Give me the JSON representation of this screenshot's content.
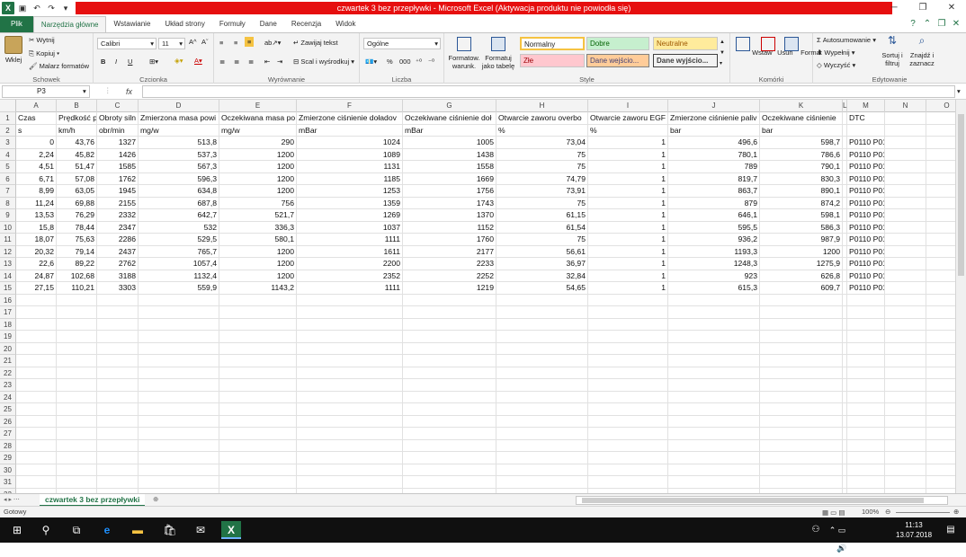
{
  "window": {
    "title": "czwartek 3 bez przepływki  -  Microsoft Excel (Aktywacja produktu nie powiodła się)",
    "qat_icons": [
      "excel-logo-icon",
      "save-icon",
      "undo-icon",
      "redo-icon",
      "customize-icon"
    ],
    "controls": {
      "restore": "🗗",
      "close": "✕",
      "minimize": "?"
    }
  },
  "tabs": [
    "Plik",
    "Narzędzia główne",
    "Wstawianie",
    "Układ strony",
    "Formuły",
    "Dane",
    "Recenzja",
    "Widok"
  ],
  "active_tab": "Narzędzia główne",
  "ribbon": {
    "clipboard": {
      "label": "Schowek",
      "paste": "Wklej",
      "cut": "Wytnij",
      "copy": "Kopiuj",
      "painter": "Malarz formatów"
    },
    "font": {
      "label": "Czcionka",
      "name": "Calibri",
      "size": "11",
      "bold": "B",
      "italic": "I",
      "underline": "U"
    },
    "alignment": {
      "label": "Wyrównanie",
      "wrap": "Zawijaj tekst",
      "merge": "Scal i wyśrodkuj"
    },
    "number": {
      "label": "Liczba",
      "format": "Ogólne",
      "pct": "%",
      "thousand": "000"
    },
    "styles": {
      "label": "Style",
      "conditional": "Formatow. warunk.",
      "astable": "Formatuj jako tabelę",
      "normal": "Normalny",
      "good": "Dobre",
      "neutral": "Neutralne",
      "bad": "Złe",
      "input": "Dane wejścio...",
      "output": "Dane wyjścio..."
    },
    "cells": {
      "label": "Komórki",
      "insert": "Wstaw",
      "delete": "Usuń",
      "format": "Format"
    },
    "editing": {
      "label": "Edytowanie",
      "autosum": "Autosumowanie",
      "fill": "Wypełnij",
      "clear": "Wyczyść",
      "sort": "Sortuj i filtruj",
      "find": "Znajdź i zaznacz"
    }
  },
  "formula_bar": {
    "name_box": "P3",
    "fx": "fx",
    "content": ""
  },
  "columns": [
    "A",
    "B",
    "C",
    "D",
    "E",
    "F",
    "G",
    "H",
    "I",
    "J",
    "K",
    "L",
    "M",
    "N",
    "O"
  ],
  "rows": [
    [
      "Czas",
      "Prędkość p",
      "Obroty siln",
      "Zmierzona masa powi",
      "Oczekiwana masa po",
      "Zmierzone ciśnienie doładov",
      "Oczekiwane ciśnienie doł",
      "Otwarcie zaworu overbo",
      "Otwarcie zaworu EGF",
      "Zmierzone ciśnienie paliv",
      "Oczekiwane ciśnienie",
      "",
      "DTC",
      "",
      ""
    ],
    [
      "s",
      "km/h",
      "obr/min",
      "mg/w",
      "mg/w",
      "mBar",
      "mBar",
      "%",
      "%",
      "bar",
      "bar",
      "",
      "",
      "",
      ""
    ],
    [
      "0",
      "43,76",
      "1327",
      "513,8",
      "290",
      "1024",
      "1005",
      "73,04",
      "1",
      "496,6",
      "598,7",
      "",
      "P0110 P0101",
      "",
      ""
    ],
    [
      "2,24",
      "45,82",
      "1426",
      "537,3",
      "1200",
      "1089",
      "1438",
      "75",
      "1",
      "780,1",
      "786,6",
      "",
      "P0110 P0101",
      "",
      ""
    ],
    [
      "4,51",
      "51,47",
      "1585",
      "567,3",
      "1200",
      "1131",
      "1558",
      "75",
      "1",
      "789",
      "790,1",
      "",
      "P0110 P0101",
      "",
      ""
    ],
    [
      "6,71",
      "57,08",
      "1762",
      "596,3",
      "1200",
      "1185",
      "1669",
      "74,79",
      "1",
      "819,7",
      "830,3",
      "",
      "P0110 P0101",
      "",
      ""
    ],
    [
      "8,99",
      "63,05",
      "1945",
      "634,8",
      "1200",
      "1253",
      "1756",
      "73,91",
      "1",
      "863,7",
      "890,1",
      "",
      "P0110 P0101",
      "",
      ""
    ],
    [
      "11,24",
      "69,88",
      "2155",
      "687,8",
      "756",
      "1359",
      "1743",
      "75",
      "1",
      "879",
      "874,2",
      "",
      "P0110 P0101",
      "",
      ""
    ],
    [
      "13,53",
      "76,29",
      "2332",
      "642,7",
      "521,7",
      "1269",
      "1370",
      "61,15",
      "1",
      "646,1",
      "598,1",
      "",
      "P0110 P0101",
      "",
      ""
    ],
    [
      "15,8",
      "78,44",
      "2347",
      "532",
      "336,3",
      "1037",
      "1152",
      "61,54",
      "1",
      "595,5",
      "586,3",
      "",
      "P0110 P0101",
      "",
      ""
    ],
    [
      "18,07",
      "75,63",
      "2286",
      "529,5",
      "580,1",
      "1111",
      "1760",
      "75",
      "1",
      "936,2",
      "987,9",
      "",
      "P0110 P0101",
      "",
      ""
    ],
    [
      "20,32",
      "79,14",
      "2437",
      "765,7",
      "1200",
      "1611",
      "2177",
      "56,61",
      "1",
      "1193,3",
      "1200",
      "",
      "P0110 P0101",
      "",
      ""
    ],
    [
      "22,6",
      "89,22",
      "2762",
      "1057,4",
      "1200",
      "2200",
      "2233",
      "36,97",
      "1",
      "1248,3",
      "1275,9",
      "",
      "P0110 P0101",
      "",
      ""
    ],
    [
      "24,87",
      "102,68",
      "3188",
      "1132,4",
      "1200",
      "2352",
      "2252",
      "32,84",
      "1",
      "923",
      "626,8",
      "",
      "P0110 P0101",
      "",
      ""
    ],
    [
      "27,15",
      "110,21",
      "3303",
      "559,9",
      "1143,2",
      "1111",
      "1219",
      "54,65",
      "1",
      "615,3",
      "609,7",
      "",
      "P0110 P0101",
      "",
      ""
    ]
  ],
  "row_count": 32,
  "sheet_tab": "czwartek 3 bez przepływki",
  "status": {
    "ready": "Gotowy",
    "zoom": "100%"
  },
  "taskbar": {
    "time": "11:13",
    "date": "13.07.2018"
  }
}
